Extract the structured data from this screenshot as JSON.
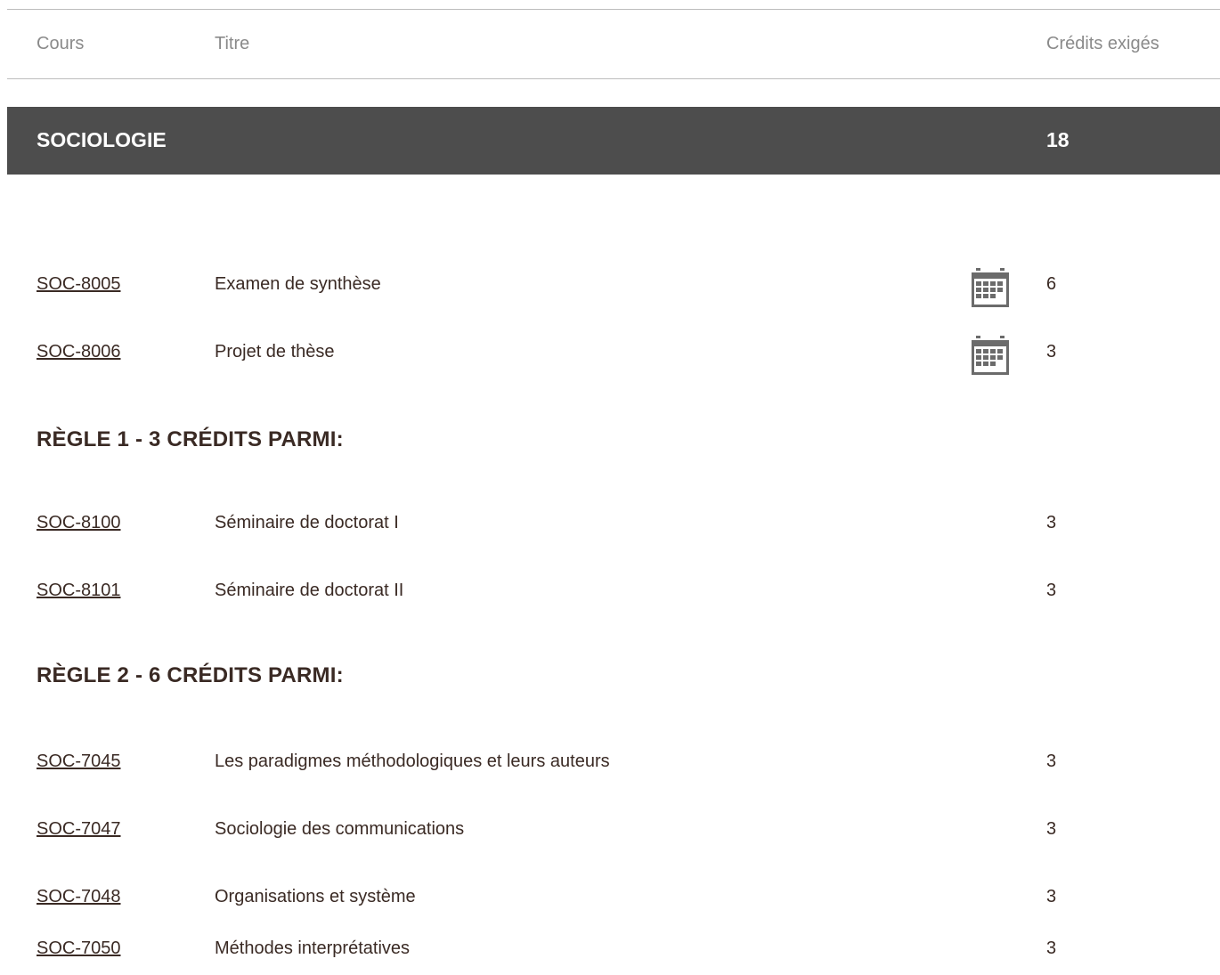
{
  "table_header": {
    "col_course": "Cours",
    "col_title": "Titre",
    "col_credits": "Crédits exigés"
  },
  "section": {
    "name": "SOCIOLOGIE",
    "credits": "18"
  },
  "mandatory_courses": [
    {
      "code": "SOC-8005",
      "title": "Examen de synthèse",
      "credits": "6",
      "icon": "calendar-icon"
    },
    {
      "code": "SOC-8006",
      "title": "Projet de thèse",
      "credits": "3",
      "icon": "calendar-icon"
    }
  ],
  "rule1": {
    "title": "RÈGLE 1 - 3 CRÉDITS PARMI:",
    "courses": [
      {
        "code": "SOC-8100",
        "title": "Séminaire de doctorat I",
        "credits": "3"
      },
      {
        "code": "SOC-8101",
        "title": "Séminaire de doctorat II",
        "credits": "3"
      }
    ]
  },
  "rule2": {
    "title": "RÈGLE 2 - 6 CRÉDITS PARMI:",
    "courses": [
      {
        "code": "SOC-7045",
        "title": "Les paradigmes méthodologiques et leurs auteurs",
        "credits": "3"
      },
      {
        "code": "SOC-7047",
        "title": "Sociologie des communications",
        "credits": "3"
      },
      {
        "code": "SOC-7048",
        "title": "Organisations et système",
        "credits": "3"
      },
      {
        "code": "SOC-7050",
        "title": "Méthodes interprétatives",
        "credits": "3"
      }
    ]
  },
  "colors": {
    "section_bar": "#4d4d4d",
    "text": "#3a2a24",
    "header_text": "#8a8a8a"
  }
}
